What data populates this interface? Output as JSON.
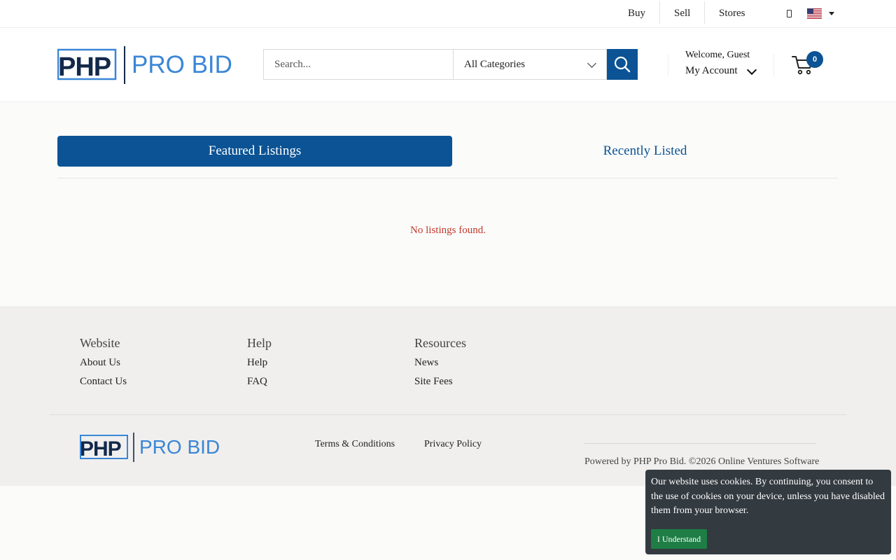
{
  "topbar": {
    "links": [
      "Buy",
      "Sell",
      "Stores"
    ],
    "icons": [
      "phone-icon",
      "us-flag-icon",
      "caret-down-icon"
    ]
  },
  "header": {
    "logo_left": "PHP",
    "logo_right": "PRO BID",
    "search_placeholder": "Search...",
    "category_selected": "All Categories",
    "welcome": "Welcome, Guest",
    "my_account": "My Account",
    "cart_count": "0"
  },
  "tabs": {
    "featured": "Featured Listings",
    "recent": "Recently Listed"
  },
  "content": {
    "empty_message": "No listings found."
  },
  "footer": {
    "columns": [
      {
        "title": "Website",
        "links": [
          "About Us",
          "Contact Us"
        ]
      },
      {
        "title": "Help",
        "links": [
          "Help",
          "FAQ"
        ]
      },
      {
        "title": "Resources",
        "links": [
          "News",
          "Site Fees"
        ]
      }
    ],
    "bottom_links": [
      "Terms & Conditions",
      "Privacy Policy"
    ],
    "powered": "Powered by PHP Pro Bid. ©2026 Online Ventures Software"
  },
  "cookie": {
    "text": "Our website uses cookies. By continuing, you consent to the use of cookies on your device, unless you have disabled them from your browser.",
    "button": "I Understand"
  },
  "colors": {
    "brand": "#0b5394",
    "logo_light": "#3a86d6",
    "error": "#c0392b",
    "cookie_bg": "#333a40",
    "cookie_btn": "#1e7e45"
  }
}
